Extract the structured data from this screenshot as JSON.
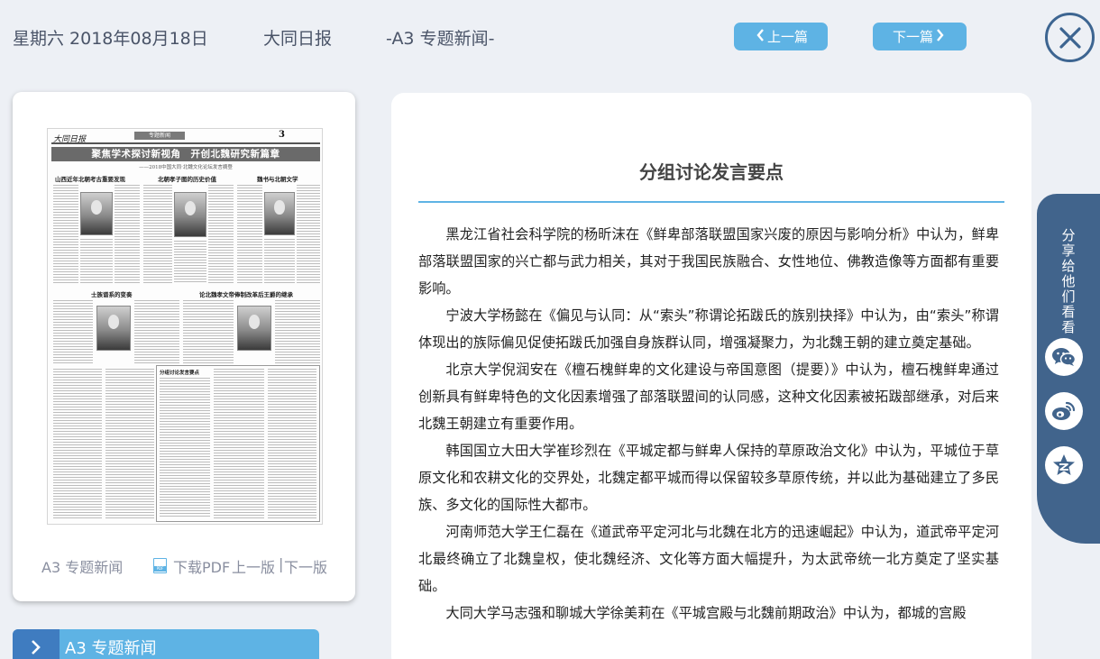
{
  "header": {
    "date": "星期六 2018年08月18日",
    "paper_name": "大同日报",
    "section": "-A3 专题新闻-",
    "prev_label": "上一篇",
    "next_label": "下一篇"
  },
  "thumbnail": {
    "logo": "大同日报",
    "section_tag": "专题新闻",
    "page_num": "3",
    "headline": "聚焦学术探讨新视角　开创北魏研究新篇章",
    "subhead": "——2018中国大同·北魏文化论坛发言摘登",
    "sub_headlines": [
      "山西近年北朝考古重要发现",
      "北朝孝子图的历史价值",
      "魏书与北朝文学",
      "士族谱系的变奏",
      "论北魏孝文帝俸制改革后王爵的继承",
      "分组讨论发言要点"
    ]
  },
  "thumb_links": {
    "section": "A3 专题新闻",
    "download": "下载PDF",
    "prev_edition": "上一版",
    "separator": "|",
    "next_edition": "下一版"
  },
  "section_bar": {
    "label": "A3  专题新闻"
  },
  "article": {
    "title": "分组讨论发言要点",
    "paragraphs": [
      "黑龙江省社会科学院的杨昕沫在《鲜卑部落联盟国家兴废的原因与影响分析》中认为，鲜卑部落联盟国家的兴亡都与武力相关，其对于我国民族融合、女性地位、佛教造像等方面都有重要影响。",
      "宁波大学杨懿在《偏见与认同：从“索头”称谓论拓跋氏的族别抉择》中认为，由“索头”称谓体现出的族际偏见促使拓跋氏加强自身族群认同，增强凝聚力，为北魏王朝的建立奠定基础。",
      "北京大学倪润安在《檀石槐鲜卑的文化建设与帝国意图（提要）》中认为，檀石槐鲜卑通过创新具有鲜卑特色的文化因素增强了部落联盟间的认同感，这种文化因素被拓跋部继承，对后来北魏王朝建立有重要作用。",
      "韩国国立大田大学崔珍烈在《平城定都与鲜卑人保持的草原政治文化》中认为，平城位于草原文化和农耕文化的交界处，北魏定都平城而得以保留较多草原传统，并以此为基础建立了多民族、多文化的国际性大都市。",
      "河南师范大学王仁磊在《道武帝平定河北与北魏在北方的迅速崛起》中认为，道武帝平定河北最终确立了北魏皇权，使北魏经济、文化等方面大幅提升，为太武帝统一北方奠定了坚实基础。",
      "大同大学马志强和聊城大学徐美莉在《平城宫殿与北魏前期政治》中认为，都城的宫殿"
    ]
  },
  "share": {
    "label": "分享给他们看看",
    "buttons": [
      "wechat-icon",
      "weibo-icon",
      "qzone-icon"
    ]
  },
  "colors": {
    "accent": "#5eb3e4",
    "dark_accent": "#41648c",
    "background": "#edf0f5"
  }
}
